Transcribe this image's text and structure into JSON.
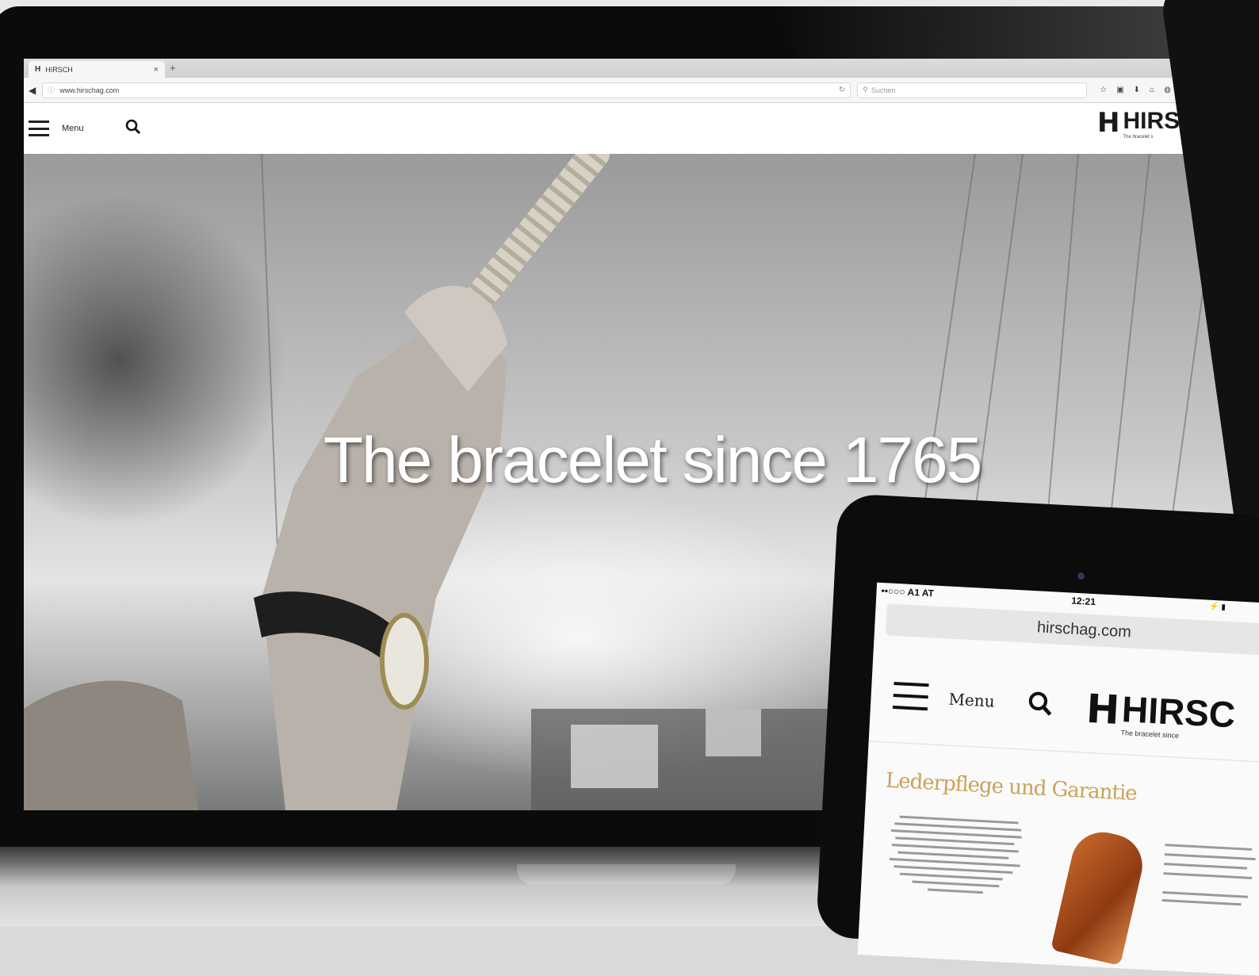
{
  "laptop": {
    "browser": {
      "tab_title": "HIRSCH",
      "tab_close": "×",
      "new_tab": "+",
      "url": "www.hirschag.com",
      "search_placeholder": "Suchen"
    },
    "site": {
      "menu_label": "Menu",
      "brand_mark": "H",
      "brand_name": "HIRS",
      "brand_tagline": "The bracelet s"
    },
    "hero": {
      "headline": "The bracelet since 1765"
    }
  },
  "tablet": {
    "status": {
      "carrier": "••○○○ A1 AT",
      "time": "12:21",
      "battery": "⚡ ▮"
    },
    "url": "hirschag.com",
    "site": {
      "menu_label": "Menu",
      "brand_mark": "H",
      "brand_name": "HIRSC",
      "brand_tagline": "The bracelet since"
    },
    "content": {
      "heading": "Lederpflege und Garantie"
    }
  },
  "colors": {
    "accent_gold": "#c8a35a",
    "device_black": "#0b0b0b"
  }
}
